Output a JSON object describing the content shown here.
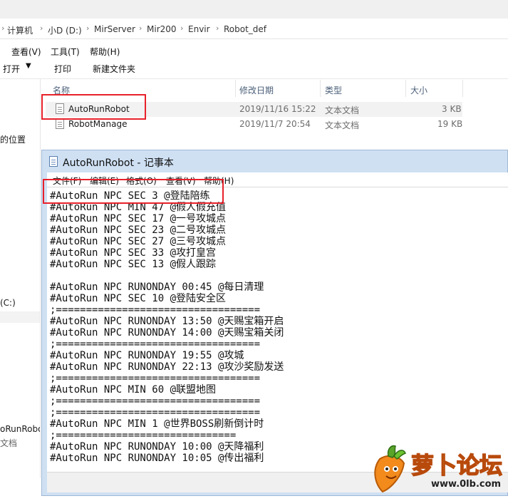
{
  "breadcrumb": [
    "计算机",
    "小D (D:)",
    "MirServer",
    "Mir200",
    "Envir",
    "Robot_def"
  ],
  "menu": [
    "查看(V)",
    "工具(T)",
    "帮助(H)"
  ],
  "toolbar": {
    "open": "打开",
    "burn": "打印",
    "new_folder": "新建文件夹"
  },
  "navpane": {
    "location": "的位置",
    "drive": "(C:)",
    "file_name": "oRunRobot",
    "file_type": "文档"
  },
  "columns": {
    "name": "名称",
    "date": "修改日期",
    "type": "类型",
    "size": "大小"
  },
  "files": [
    {
      "name": "AutoRunRobot",
      "date": "2019/11/16 15:22",
      "type": "文本文档",
      "size": "3 KB"
    },
    {
      "name": "RobotManage",
      "date": "2019/11/7 20:54",
      "type": "文本文档",
      "size": "19 KB"
    }
  ],
  "notepad": {
    "title": "AutoRunRobot - 记事本",
    "menu": [
      "文件(F)",
      "编辑(E)",
      "格式(O)",
      "查看(V)",
      "帮助(H)"
    ],
    "lines": [
      "#AutoRun NPC SEC 3 @登陆陪练",
      "#AutoRun NPC MIN 47 @假人假充值",
      "#AutoRun NPC SEC 17 @一号攻城点",
      "#AutoRun NPC SEC 23 @二号攻城点",
      "#AutoRun NPC SEC 27 @三号攻城点",
      "#AutoRun NPC SEC 33 @攻打皇宫",
      "#AutoRun NPC SEC 13 @假人跟踪",
      "",
      "#AutoRun NPC RUNONDAY 00:45 @每日清理",
      "#AutoRun NPC SEC 10 @登陆安全区",
      ";==================================",
      "#AutoRun NPC RUNONDAY 13:50 @天赐宝箱开启",
      "#AutoRun NPC RUNONDAY 14:00 @天赐宝箱关闭",
      ";==================================",
      "#AutoRun NPC RUNONDAY 19:55 @攻城",
      "#AutoRun NPC RUNONDAY 22:13 @攻沙奖励发送",
      ";==================================",
      "#AutoRun NPC MIN 60 @联盟地图",
      ";==================================",
      ";==================================",
      "#AutoRun NPC MIN 1 @世界BOSS刷新倒计时",
      ";==============================",
      "#AutoRun NPC RUNONDAY 10:00 @天降福利",
      "#AutoRun NPC RUNONDAY 10:05 @传出福利"
    ]
  },
  "watermark": {
    "text": "萝卜论坛",
    "url": "www.0lb.com"
  },
  "colors": {
    "highlight_box": "#e8212a",
    "notepad_frame": "#cfe0f3",
    "column_header": "#4c607a"
  }
}
